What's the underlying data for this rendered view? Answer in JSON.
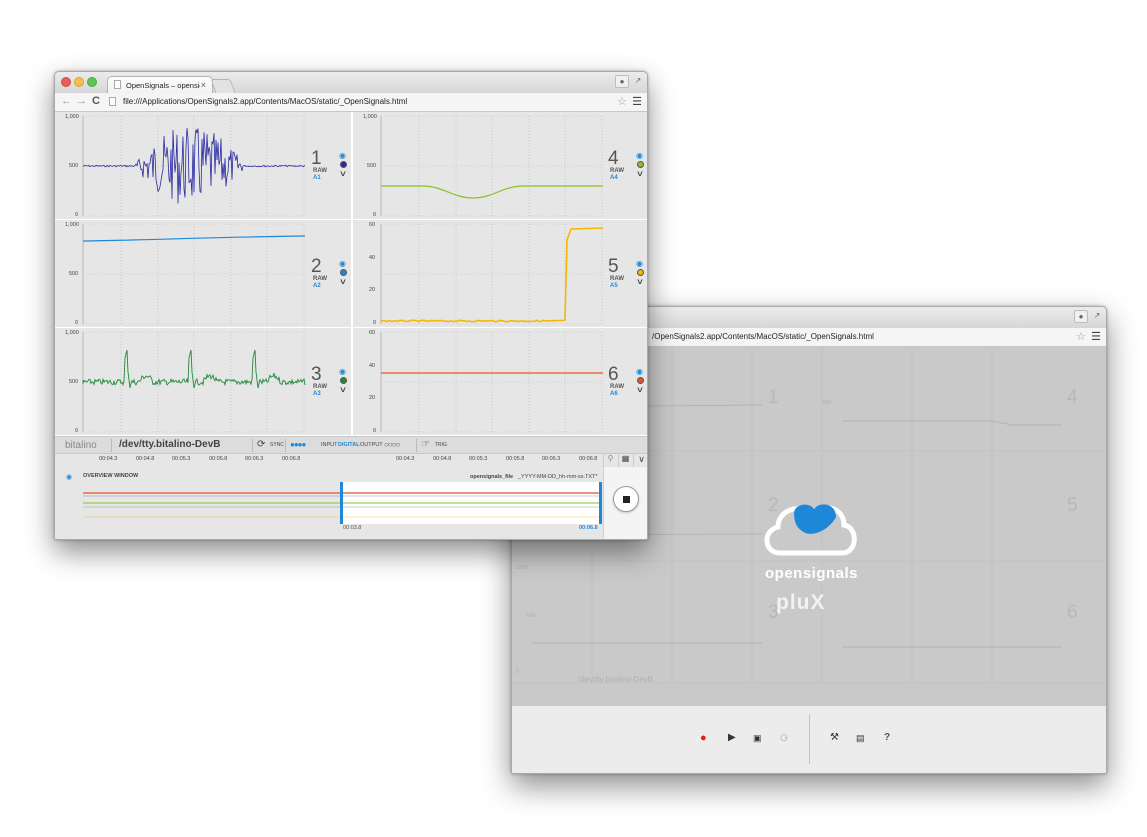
{
  "front": {
    "tab_title": "OpenSignals – opensignals",
    "url": "file:///Applications/OpenSignals2.app/Contents/MacOS/static/_OpenSignals.html",
    "channels": [
      {
        "num": "1",
        "mode": "RAW",
        "id": "A1",
        "color": "#2a2aa0",
        "yticks": [
          "1,000",
          "500",
          "0"
        ]
      },
      {
        "num": "2",
        "mode": "RAW",
        "id": "A2",
        "color": "#1e88d8",
        "yticks": [
          "1,000",
          "500",
          "0"
        ]
      },
      {
        "num": "3",
        "mode": "RAW",
        "id": "A3",
        "color": "#1f8a3a",
        "yticks": [
          "1,000",
          "500",
          "0"
        ]
      },
      {
        "num": "4",
        "mode": "RAW",
        "id": "A4",
        "color": "#8cbf26",
        "yticks": [
          "1,000",
          "500",
          "0"
        ]
      },
      {
        "num": "5",
        "mode": "RAW",
        "id": "A5",
        "color": "#f5b800",
        "yticks": [
          "60",
          "40",
          "20",
          "0"
        ]
      },
      {
        "num": "6",
        "mode": "RAW",
        "id": "A6",
        "color": "#e5542a",
        "yticks": [
          "60",
          "40",
          "20",
          "0"
        ]
      }
    ],
    "status": {
      "brand": "bitalino",
      "device": "/dev/tty.bitalino-DevB",
      "sync": "SYNC",
      "input": "INPUT",
      "digital": "DIGITAL",
      "output": "OUTPUT",
      "trig": "TRIG"
    },
    "xticks_left": [
      "00:04.3",
      "00:04.8",
      "00:05.3",
      "00:05.8",
      "00:06.3",
      "00:06.8"
    ],
    "xticks_right": [
      "00:04.3",
      "00:04.8",
      "00:05.3",
      "00:05.8",
      "00:06.3",
      "00:06.8"
    ],
    "overview": {
      "label": "OVERVIEW WINDOW",
      "file_label": "opensignals_file",
      "file_pattern": "_YYYY-MM-DD_hh-mm-ss.TXT*",
      "start": "00:03.8",
      "end": "00:06.8"
    }
  },
  "back": {
    "tab_close": "×",
    "url": "/OpenSignals2.app/Contents/MacOS/static/_OpenSignals.html",
    "brand": "opensignals",
    "vendor": "pluX",
    "faint": {
      "device": "/dev/tty.bitalino-DevB",
      "nums": [
        "1",
        "2",
        "3",
        "4",
        "5",
        "6"
      ],
      "yticks": [
        "1000",
        "500",
        "500",
        "1000",
        "500",
        "0"
      ]
    },
    "footer": {
      "record_color": "#e31b1b",
      "icons": [
        "record-icon",
        "play-icon",
        "save-icon",
        "mic-icon",
        "wrench-icon",
        "cart-icon",
        "help-icon"
      ],
      "help": "?"
    }
  }
}
